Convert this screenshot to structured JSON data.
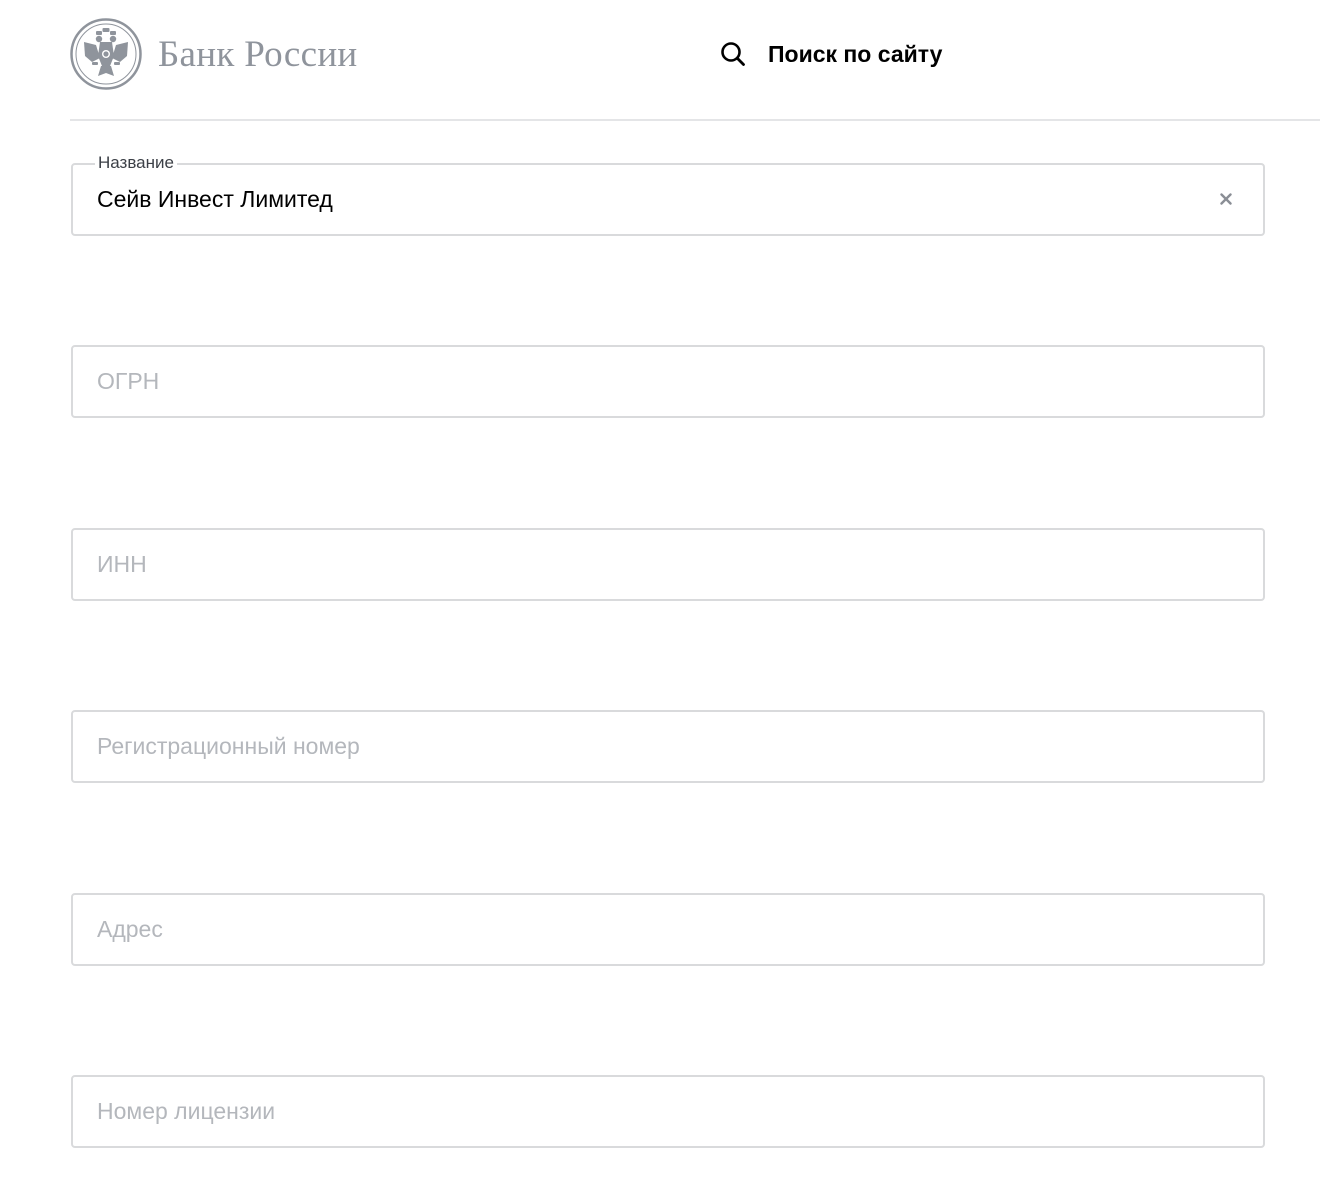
{
  "header": {
    "logo_text": "Банк России",
    "search_label": "Поиск по сайту"
  },
  "form": {
    "name_field": {
      "label": "Название",
      "value": "Сейв Инвест Лимитед"
    },
    "ogrn_field": {
      "placeholder": "ОГРН"
    },
    "inn_field": {
      "placeholder": "ИНН"
    },
    "reg_number_field": {
      "placeholder": "Регистрационный номер"
    },
    "address_field": {
      "placeholder": "Адрес"
    },
    "license_number_field": {
      "placeholder": "Номер лицензии"
    }
  },
  "icons": {
    "logo": "double-headed-eagle-emblem",
    "search": "search-icon",
    "clear": "close-icon"
  },
  "colors": {
    "logo_gray": "#8f949c",
    "border": "#d9dadc",
    "placeholder": "#b4b7bc",
    "text": "#000000"
  }
}
